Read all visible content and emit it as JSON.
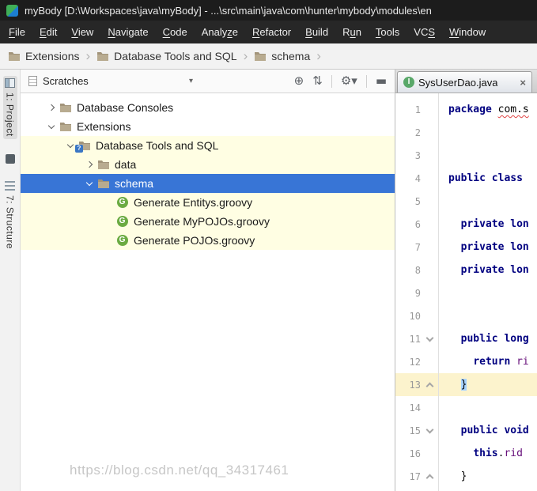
{
  "title_bar": {
    "title": "myBody [D:\\Workspaces\\java\\myBody] - ...\\src\\main\\java\\com\\hunter\\mybody\\modules\\en"
  },
  "menu": {
    "items": [
      {
        "label": "File",
        "underline": 0
      },
      {
        "label": "Edit",
        "underline": 0
      },
      {
        "label": "View",
        "underline": 0
      },
      {
        "label": "Navigate",
        "underline": 0
      },
      {
        "label": "Code",
        "underline": 0
      },
      {
        "label": "Analyze",
        "underline": 5
      },
      {
        "label": "Refactor",
        "underline": 0
      },
      {
        "label": "Build",
        "underline": 0
      },
      {
        "label": "Run",
        "underline": 1
      },
      {
        "label": "Tools",
        "underline": 0
      },
      {
        "label": "VCS",
        "underline": 2
      },
      {
        "label": "Window",
        "underline": 0
      }
    ]
  },
  "breadcrumbs": {
    "items": [
      "Extensions",
      "Database Tools and SQL",
      "schema"
    ],
    "separator": "›"
  },
  "tool_strip": {
    "buttons": [
      {
        "label": "1: Project",
        "icon": "project-tool-icon",
        "active": true
      },
      {
        "label": "",
        "icon": "bookmark-icon",
        "active": false
      },
      {
        "label": "7: Structure",
        "icon": "structure-tool-icon",
        "active": false
      }
    ]
  },
  "project_panel": {
    "scope_selector": "Scratches",
    "toolbar": [
      {
        "name": "locate",
        "glyph": "⊕"
      },
      {
        "name": "collapse-all",
        "glyph": "⇅"
      },
      {
        "name": "divider",
        "glyph": ""
      },
      {
        "name": "settings",
        "glyph": "⚙▾"
      },
      {
        "name": "divider",
        "glyph": ""
      },
      {
        "name": "hide",
        "glyph": "▬"
      }
    ],
    "tree": [
      {
        "label": "Database Consoles",
        "level": 0,
        "arrow": "collapsed",
        "icon": "folder",
        "bg": "",
        "selected": false
      },
      {
        "label": "Extensions",
        "level": 0,
        "arrow": "expanded",
        "icon": "folder",
        "bg": "",
        "selected": false
      },
      {
        "label": "Database Tools and SQL",
        "level": 1,
        "arrow": "expanded",
        "icon": "plugin",
        "bg": "cream",
        "selected": false
      },
      {
        "label": "data",
        "level": 2,
        "arrow": "collapsed",
        "icon": "folder",
        "bg": "cream",
        "selected": false
      },
      {
        "label": "schema",
        "level": 2,
        "arrow": "expanded",
        "icon": "folder",
        "bg": "cream",
        "selected": true
      },
      {
        "label": "Generate Entitys.groovy",
        "level": 3,
        "arrow": null,
        "icon": "groovy",
        "bg": "cream",
        "selected": false
      },
      {
        "label": "Generate MyPOJOs.groovy",
        "level": 3,
        "arrow": null,
        "icon": "groovy",
        "bg": "cream",
        "selected": false
      },
      {
        "label": "Generate POJOs.groovy",
        "level": 3,
        "arrow": null,
        "icon": "groovy",
        "bg": "cream",
        "selected": false
      }
    ]
  },
  "editor": {
    "tab": {
      "label": "SysUserDao.java",
      "icon": "interface",
      "close_glyph": "×"
    },
    "lines": [
      {
        "num": 1,
        "fold": null,
        "current": false,
        "tokens": [
          {
            "t": "package",
            "c": "keyword"
          },
          {
            "t": " ",
            "c": "plain"
          },
          {
            "t": "com.s",
            "c": "error"
          }
        ]
      },
      {
        "num": 2,
        "fold": null,
        "current": false,
        "tokens": []
      },
      {
        "num": 3,
        "fold": null,
        "current": false,
        "tokens": []
      },
      {
        "num": 4,
        "fold": null,
        "current": false,
        "tokens": [
          {
            "t": "public class ",
            "c": "keyword"
          }
        ]
      },
      {
        "num": 5,
        "fold": null,
        "current": false,
        "tokens": []
      },
      {
        "num": 6,
        "fold": null,
        "current": false,
        "tokens": [
          {
            "t": "  ",
            "c": "plain"
          },
          {
            "t": "private lon",
            "c": "keyword"
          }
        ]
      },
      {
        "num": 7,
        "fold": null,
        "current": false,
        "tokens": [
          {
            "t": "  ",
            "c": "plain"
          },
          {
            "t": "private lon",
            "c": "keyword"
          }
        ]
      },
      {
        "num": 8,
        "fold": null,
        "current": false,
        "tokens": [
          {
            "t": "  ",
            "c": "plain"
          },
          {
            "t": "private lon",
            "c": "keyword"
          }
        ]
      },
      {
        "num": 9,
        "fold": null,
        "current": false,
        "tokens": []
      },
      {
        "num": 10,
        "fold": null,
        "current": false,
        "tokens": []
      },
      {
        "num": 11,
        "fold": "down",
        "current": false,
        "tokens": [
          {
            "t": "  ",
            "c": "plain"
          },
          {
            "t": "public long",
            "c": "keyword"
          }
        ]
      },
      {
        "num": 12,
        "fold": null,
        "current": false,
        "tokens": [
          {
            "t": "    ",
            "c": "plain"
          },
          {
            "t": "return ",
            "c": "keyword"
          },
          {
            "t": "ri",
            "c": "field"
          }
        ]
      },
      {
        "num": 13,
        "fold": "up",
        "current": true,
        "tokens": [
          {
            "t": "  ",
            "c": "plain"
          },
          {
            "t": "}",
            "c": "brace"
          }
        ]
      },
      {
        "num": 14,
        "fold": null,
        "current": false,
        "tokens": []
      },
      {
        "num": 15,
        "fold": "down",
        "current": false,
        "tokens": [
          {
            "t": "  ",
            "c": "plain"
          },
          {
            "t": "public void",
            "c": "keyword"
          }
        ]
      },
      {
        "num": 16,
        "fold": null,
        "current": false,
        "tokens": [
          {
            "t": "    ",
            "c": "plain"
          },
          {
            "t": "this",
            "c": "keyword"
          },
          {
            "t": ".",
            "c": "plain"
          },
          {
            "t": "rid",
            "c": "field"
          }
        ]
      },
      {
        "num": 17,
        "fold": "up",
        "current": false,
        "tokens": [
          {
            "t": "  ",
            "c": "plain"
          },
          {
            "t": "}",
            "c": "plain"
          }
        ]
      }
    ]
  },
  "watermark": "https://blog.csdn.net/qq_34317461",
  "colors": {
    "selection_blue": "#3875d6",
    "tree_highlight_cream": "#fffee3",
    "caret_line": "#fcf3cd",
    "keyword_navy": "#000080",
    "field_purple": "#660e7a",
    "error_red": "#e04444",
    "brace_match_blue": "#a8d3ff"
  }
}
